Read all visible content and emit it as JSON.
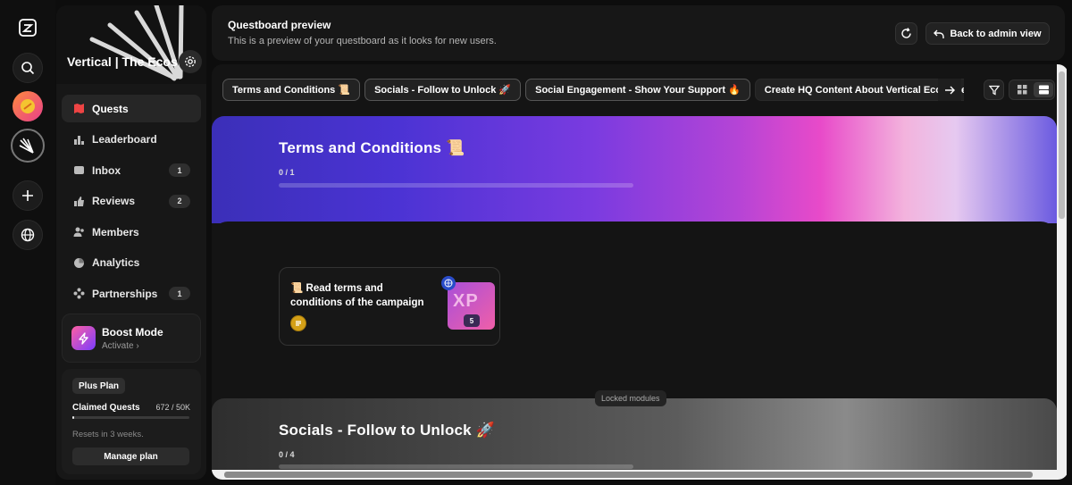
{
  "sidebar": {
    "workspace_title": "Vertical | The Ecosystem",
    "nav": [
      {
        "label": "Quests",
        "badge": ""
      },
      {
        "label": "Leaderboard",
        "badge": ""
      },
      {
        "label": "Inbox",
        "badge": "1"
      },
      {
        "label": "Reviews",
        "badge": "2"
      },
      {
        "label": "Members",
        "badge": ""
      },
      {
        "label": "Analytics",
        "badge": ""
      },
      {
        "label": "Partnerships",
        "badge": "1"
      }
    ],
    "boost": {
      "title": "Boost Mode",
      "subtitle": "Activate"
    },
    "plan": {
      "badge": "Plus Plan",
      "label": "Claimed Quests",
      "count": "672 / 50K",
      "progress": 0.013,
      "reset": "Resets in 3 weeks.",
      "button": "Manage plan"
    }
  },
  "header": {
    "title": "Questboard preview",
    "subtitle": "This is a preview of your questboard as it looks for new users.",
    "back_button": "Back to admin view"
  },
  "tabs": [
    "Terms and Conditions 📜",
    "Socials - Follow to Unlock 🚀",
    "Social Engagement - Show Your Support 🔥",
    "Create HQ Content About Vertical Ecosystem"
  ],
  "modules": [
    {
      "title": "Terms and Conditions 📜",
      "count": "0 / 1",
      "quests": [
        {
          "title": "📜 Read terms and conditions of the campaign",
          "xp_label": "XP",
          "xp": "5"
        }
      ]
    },
    {
      "title": "Socials - Follow to Unlock 🚀",
      "count": "0 / 4",
      "locked_label": "Locked modules"
    }
  ],
  "colors": {
    "accent_gradient_start": "#3b2fb8",
    "accent_gradient_end": "#e84ac9",
    "background": "#0d0d0d"
  }
}
